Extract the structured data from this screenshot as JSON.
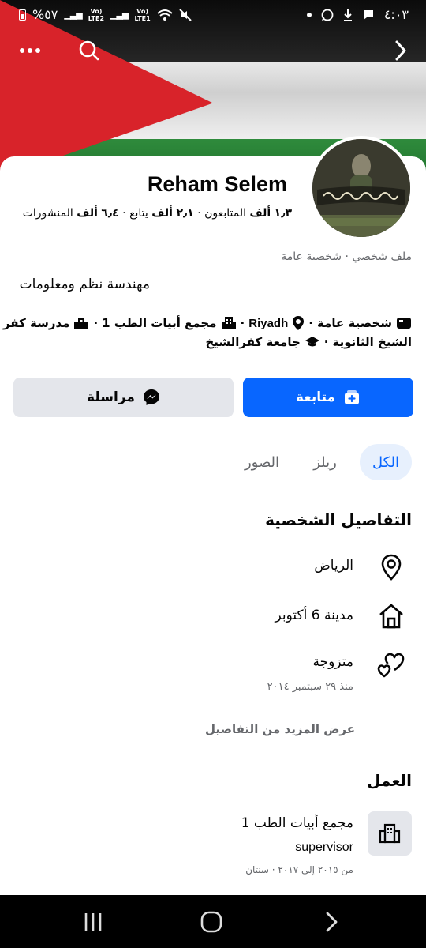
{
  "status_bar": {
    "time": "٤:٠٣",
    "battery": "%٥٧",
    "sim1": "Vo)) LTE1",
    "sim2": "Vo)) LTE2",
    "sim1_label": "LTE1",
    "sim2_label": "LTE2"
  },
  "profile": {
    "name": "Reham Selem",
    "stats": {
      "followers_value": "١٫٣",
      "followers_unit": "ألف",
      "followers_label": "المتابعون",
      "following_value": "٢٫١",
      "following_unit": "ألف",
      "following_label": "يتابع",
      "posts_value": "٦٫٤",
      "posts_unit": "ألف",
      "posts_label": "المنشورات"
    },
    "category": "ملف شخصي · شخصية عامة",
    "bio": "مهندسة نظم ومعلومات",
    "info_line1_a": "شخصية عامة",
    "info_line1_b": "Riyadh",
    "info_line1_c": "مجمع أبيات الطب 1",
    "info_line1_d": "مدرسة كفر",
    "info_line2_a": "الشيخ الثانوية",
    "info_line2_b": "جامعة كفرالشيخ",
    "follow_button": "متابعة",
    "message_button": "مراسلة"
  },
  "tabs": [
    "الكل",
    "ريلز",
    "الصور"
  ],
  "personal_details": {
    "title": "التفاصيل الشخصية",
    "location": "الرياض",
    "hometown": "مدينة 6 أكتوبر",
    "relationship": "متزوجة",
    "relationship_since": "منذ ٢٩ سبتمبر ٢٠١٤",
    "see_more": "عرض المزيد من التفاصيل"
  },
  "work": {
    "title": "العمل",
    "employer": "مجمع أبيات الطب 1",
    "position": "supervisor",
    "duration": "من ٢٠١٥ إلى ٢٠١٧ · سنتان"
  },
  "colors": {
    "accent": "#0866ff",
    "accent_tint": "#e7f0fd",
    "secondary_button": "#e4e6eb",
    "muted_text": "#65676b"
  },
  "icons": [
    "more-icon",
    "search-icon",
    "back-chevron-icon",
    "location-pin-icon",
    "home-icon",
    "hearts-icon",
    "building-icon",
    "messenger-icon",
    "add-friend-icon",
    "recents-icon",
    "home-nav-icon",
    "nav-back-icon"
  ]
}
